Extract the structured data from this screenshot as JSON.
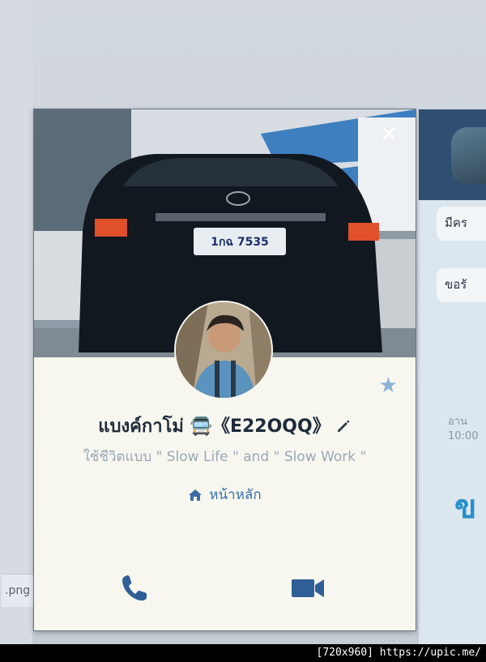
{
  "profile": {
    "name": "แบงค์กาโม่ 🚍《E22OQQ》",
    "status_message": "ใช้ชีวิตแบบ \" Slow Life \" and \" Slow Work \"",
    "home_label": "หน้าหลัก",
    "plate_text": "1กฉ 7535"
  },
  "background": {
    "left_file_label": ".png",
    "chat_bubble_1": "มีคร",
    "chat_bubble_2": "ขอรั",
    "time_label_1": "อาน",
    "time_label_2": "10:00",
    "big_glyph": "ข"
  },
  "footer": {
    "watermark": "[720x960] https://upic.me/"
  },
  "colors": {
    "accent": "#3a6ea5",
    "icon_blue": "#2f5f96",
    "card_bg": "#f7f7ef",
    "chat_header": "#2f4f72"
  },
  "icons": {
    "close": "close-icon",
    "favorite": "star-icon",
    "edit": "pencil-icon",
    "home": "home-icon",
    "call": "phone-icon",
    "video": "video-camera-icon"
  }
}
